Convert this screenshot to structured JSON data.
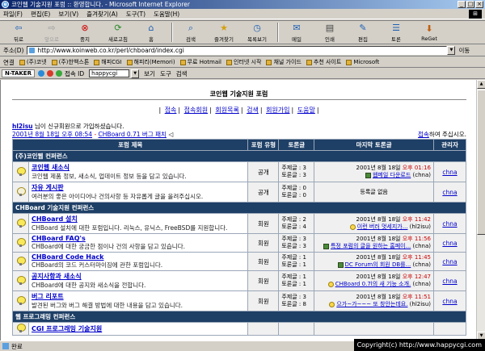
{
  "window": {
    "title": "코인웹 기술지원 포럼 :: 환영합니다. - Microsoft Internet Explorer"
  },
  "menu": [
    "파일(F)",
    "편집(E)",
    "보기(V)",
    "즐겨찾기(A)",
    "도구(T)",
    "도움말(H)"
  ],
  "toolbar": {
    "back": "뒤로",
    "forward": "앞으로",
    "stop": "중지",
    "refresh": "새로고침",
    "home": "홈",
    "search": "검색",
    "favorites": "즐겨찾기",
    "history": "목록보기",
    "mail": "메일",
    "print": "인쇄",
    "edit": "편집",
    "discuss": "토론",
    "reget": "ReGet"
  },
  "address": {
    "label": "주소(D)",
    "url": "http://www.koinweb.co.kr/perl/chboard/index.cgi",
    "go": "이동"
  },
  "links": {
    "label": "연결",
    "items": [
      "(주)코넷",
      "(주)한백스톤",
      "해피CGI",
      "해피리(Memori)",
      "무료 Hotmail",
      "인터넷 시작",
      "채널 가이드",
      "추천 사이트",
      "Microsoft"
    ]
  },
  "extra": {
    "taker": "N-TAKER",
    "id_label": "접속 ID",
    "id_value": "happycgi",
    "view": "보기",
    "tools": "도구",
    "help": "검색"
  },
  "page": {
    "title": "코인웹 기술지원 포럼",
    "nav": [
      "접속",
      "접속회원",
      "회원목록",
      "검색",
      "회원가입",
      "도움말"
    ],
    "welcome_user": "hl2isu",
    "welcome_text": " 님이 신규회원으로 가입하셨습니다.",
    "last_date": "2001년 8월 18일 오후 08:54",
    "last_sep": " - ",
    "last_link": "CHBoard 0.71 버그 패치",
    "login_link": "접속",
    "login_suffix": "하여 주십시오.",
    "headers": {
      "forum": "포럼 제목",
      "type": "포럼 유형",
      "count": "토론글",
      "last": "마지막 토론글",
      "admin": "관리자"
    }
  },
  "forum_data": {
    "categories": [
      {
        "name": "(주)코인웹 컨퍼런스",
        "forums": [
          {
            "title": "코인웹 새소식",
            "desc": "코인웹 제품 정보, 새소식, 업데이트 정보 등을 담고 있습니다.",
            "type": "공개",
            "topics": "주제글 : 3",
            "posts": "토론글 : 3",
            "date": "2001년 8월 18일 ",
            "time": "오후 01:16",
            "last": "웹메일 다운로드",
            "author": "(chna)",
            "admin": "chna",
            "active": true
          },
          {
            "title": "자유 게시판",
            "desc": "여러분의 좋은 아이디어나 건의사항 등 자유롭게 글을 올려주십시오.",
            "type": "공개",
            "topics": "주제글 : 0",
            "posts": "토론글 : 0",
            "empty": "등록글 없음",
            "admin": "chna",
            "active": false
          }
        ]
      },
      {
        "name": "CHBoard 기술지원 컨퍼런스",
        "forums": [
          {
            "title": "CHBoard 설치",
            "desc": "CHBoard 설치에 대한 포럼입니다. 리눅스, 유닉스, FreeBSD를 지원합니다.",
            "type": "회원",
            "topics": "주제글 : 2",
            "posts": "토론글 : 4",
            "date": "2001년 8월 18일 ",
            "time": "오후 11:42",
            "last": "이런 버러 멋세지가...",
            "author": "(hl2isu)",
            "admin": "chna",
            "active": true,
            "face": true
          },
          {
            "title": "CHBoard FAQ's",
            "desc": "CHBoard에 대한 궁금한 점이나 건의 사항을 담고 있습니다.",
            "type": "회원",
            "topics": "주제글 : 3",
            "posts": "토론글 : 3",
            "date": "2001년 8월 18일 ",
            "time": "오후 11:56",
            "last": "특정 포럼의 글을 원하는 홈페이...",
            "author": "(chna)",
            "admin": "chna",
            "active": true
          },
          {
            "title": "CHBoard Code Hack",
            "desc": "CHBoard의 코드 커스터마이징에 관한 포럼입니다.",
            "type": "회원",
            "topics": "주제글 : 1",
            "posts": "토론글 : 1",
            "date": "2001년 8월 18일 ",
            "time": "오후 11:45",
            "last": "DC Forum의 회원 DB를...",
            "author": "(chna)",
            "admin": "chna",
            "active": true
          },
          {
            "title": "공지사항과 새소식",
            "desc": "CHBoard에 대한 공지와 새소식을 전합니다.",
            "type": "회원",
            "topics": "주제글 : 1",
            "posts": "토론글 : 1",
            "date": "2001년 8월 18일 ",
            "time": "오후 12:47",
            "last": "CHBoard 0.7l의 새 기능 소개.",
            "author": "(chna)",
            "admin": "chna",
            "active": true,
            "face": true
          },
          {
            "title": "버그 리포트",
            "desc": "발견된 버그와 버그 해결 방법에 대한 내용을 담고 있습니다.",
            "type": "회원",
            "topics": "주제글 : 3",
            "posts": "토론글 : 8",
            "date": "2001년 8월 18일 ",
            "time": "오후 11:51",
            "last": "으가~가~~~ 또 창안는데요.",
            "author": "(hl2isu)",
            "admin": "chna",
            "active": true,
            "face": true
          }
        ]
      },
      {
        "name": "웹 프로그래밍 컨퍼런스",
        "forums": [
          {
            "title": "CGI 프로그래밍 기술지원",
            "desc": "",
            "type": "",
            "topics": "",
            "posts": "",
            "empty": "",
            "admin": "",
            "active": true
          }
        ]
      }
    ]
  },
  "status": {
    "text": "완료",
    "copyright": "Copyright(c) http://www.happycgi.com"
  }
}
